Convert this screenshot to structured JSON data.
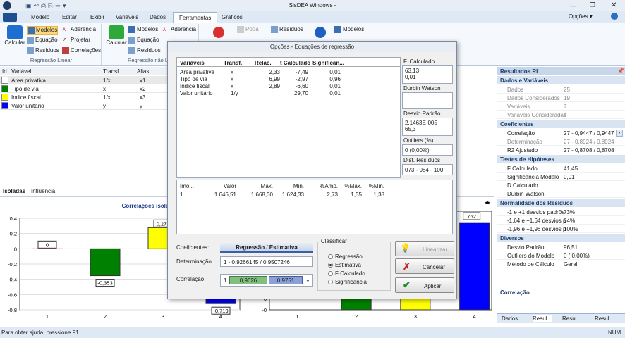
{
  "window": {
    "title": "SisDEA Windows -",
    "options": "Opções ▾"
  },
  "tabs": [
    "Modelo",
    "Editar",
    "Exibir",
    "Variáveis",
    "Dados",
    "Ferramentas",
    "Gráficos"
  ],
  "ribbon": {
    "lin": {
      "calc": "Calcular",
      "modelos": "Modelos",
      "equacao": "Equação",
      "residuos": "Resíduos",
      "aderencia": "Aderência",
      "projetar": "Projetar",
      "correlacoes": "Correlações",
      "caption": "Regressão Linear"
    },
    "nlin": {
      "calc": "Calcular",
      "modelos": "Modelos",
      "equacao": "Equação",
      "residuos": "Resíduos",
      "aderencia": "Aderência",
      "caption": "Regressão não Li..."
    },
    "poda": "Poda",
    "residuos2": "Resíduos",
    "modelos3": "Modelos"
  },
  "vars": {
    "headers": [
      "Id",
      "Variável",
      "Transf.",
      "Alias"
    ],
    "rows": [
      {
        "name": "Area privativa",
        "transf": "1/x",
        "alias": "x1",
        "color": "#ffffff"
      },
      {
        "name": "Tipo de via",
        "transf": "x",
        "alias": "x2",
        "color": "#008000"
      },
      {
        "name": "Indice fiscal",
        "transf": "1/x",
        "alias": "x3",
        "color": "#ffff00"
      },
      {
        "name": "Valor unitário",
        "transf": "y",
        "alias": "y",
        "color": "#0000ff"
      }
    ]
  },
  "lefttabs": [
    "Isoladas",
    "Influência"
  ],
  "chart_data": [
    {
      "type": "bar",
      "title": "Correlações isoladas p/Area privativa",
      "categories": [
        "1",
        "2",
        "3",
        "4"
      ],
      "values": [
        0,
        -0.353,
        0.277,
        -0.719
      ],
      "ylim": [
        -0.8,
        0.4
      ],
      "yticks": [
        "0,4",
        "0,2",
        "0",
        "-0,2",
        "-0,4",
        "-0,6",
        "-0,8"
      ],
      "labels": [
        "0",
        "-0,353",
        "0,277",
        "-0,719"
      ],
      "colors": [
        "#ff0000",
        "#008000",
        "#ffff00",
        "#0000ff"
      ]
    },
    {
      "type": "bar",
      "categories": [
        "1",
        "2",
        "3",
        "4"
      ],
      "values": [
        null,
        0.2,
        0.2,
        0.762
      ],
      "labels": [
        "",
        "",
        "",
        "762"
      ],
      "yticks": [
        "0",
        "-0"
      ]
    }
  ],
  "dialog": {
    "title": "Opções - Equações de regressão",
    "table": {
      "headers": [
        "Variáveis",
        "Transf.",
        "Relac.",
        "t Calculado",
        "Significân..."
      ],
      "rows": [
        [
          "Area privativa",
          "x",
          "2,33",
          "-7,49",
          "0,01"
        ],
        [
          "Tipo de via",
          "x",
          "6,99",
          "-2,97",
          "0,96"
        ],
        [
          "Indice fiscal",
          "x",
          "2,89",
          "-6,60",
          "0,01"
        ],
        [
          "Valor unitário",
          "1/y",
          "",
          "29,70",
          "0,01"
        ]
      ]
    },
    "side": {
      "fcalc_label": "F. Calculado",
      "fcalc": "63,13",
      "fcalc2": "0,01",
      "durbin_label": "Durbin Watson",
      "dp_label": "Desvio Padrão",
      "dp": "2,1463E-005",
      "dp2": "65,3",
      "outliers_label": "Outliers (%)",
      "outliers": "0  (0,00%)",
      "dist_label": "Dist. Resíduos",
      "dist": "073 - 084 - 100"
    },
    "imo": {
      "headers": [
        "Imo...",
        "Valor",
        "Max.",
        "Min.",
        "%Amp.",
        "%Max.",
        "%Min."
      ],
      "row": [
        "1",
        "1.646,51",
        "1.668,30",
        "1.624,33",
        "2,73",
        "1,35",
        "1,38"
      ]
    },
    "coef_label": "Coeficientes:",
    "coef_value": "Regressão / Estimativa",
    "det_label": "Determinação",
    "det_value": "1 - 0,9266145  /  0,9507246",
    "corr_label": "Correlação",
    "corr_a": "1",
    "corr_b": "0,9626",
    "corr_c": "0,9751",
    "classificar": "Classificar",
    "radios": [
      "Regressão",
      "Estimativa",
      "F Calculado",
      "Significancia"
    ],
    "btn_linearizar": "Linearizar",
    "btn_cancelar": "Cancelar",
    "btn_aplicar": "Aplicar"
  },
  "right": {
    "title": "Resultados RL",
    "dados_title": "Dados e Variáveis",
    "dados": [
      [
        "Dados",
        "25"
      ],
      [
        "Dados Considerados",
        "19"
      ],
      [
        "Variáveis",
        "7"
      ],
      [
        "Variáveis Consideradas",
        "4"
      ]
    ],
    "coef_title": "Coeficientes",
    "coef": [
      [
        "Correlação",
        "27 - 0,9447 / 0,9447"
      ],
      [
        "Determinação",
        "27 - 0,8924 / 0,8924"
      ],
      [
        "R2 Ajustado",
        "27 - 0,8708 / 0,8708"
      ]
    ],
    "testes_title": "Testes de Hipóteses",
    "testes": [
      [
        "F Calculado",
        "41,45"
      ],
      [
        "Significância Modelo",
        "0,01"
      ],
      [
        "D Calculado",
        ""
      ],
      [
        "Durbin Watson",
        ""
      ]
    ],
    "norm_title": "Normalidade dos Resíduos",
    "norm": [
      [
        "-1 e +1 desvios padrõe",
        "73%"
      ],
      [
        "-1,64 e +1,64 desvios p",
        "84%"
      ],
      [
        "-1,96 e +1,96 desvios p",
        "100%"
      ]
    ],
    "div_title": "Diversos",
    "div": [
      [
        "Desvio Padrão",
        "96,51"
      ],
      [
        "Outliers do Modelo",
        "0  ( 0,00%)"
      ],
      [
        "Método de Cálculo",
        "Geral"
      ]
    ],
    "bottom_label": "Correlação",
    "tabs": [
      "Dados",
      "Resul...",
      "Resul...",
      "Resul..."
    ]
  },
  "status": {
    "left": "Para obter ajuda, pressione F1",
    "right": "NUM"
  }
}
